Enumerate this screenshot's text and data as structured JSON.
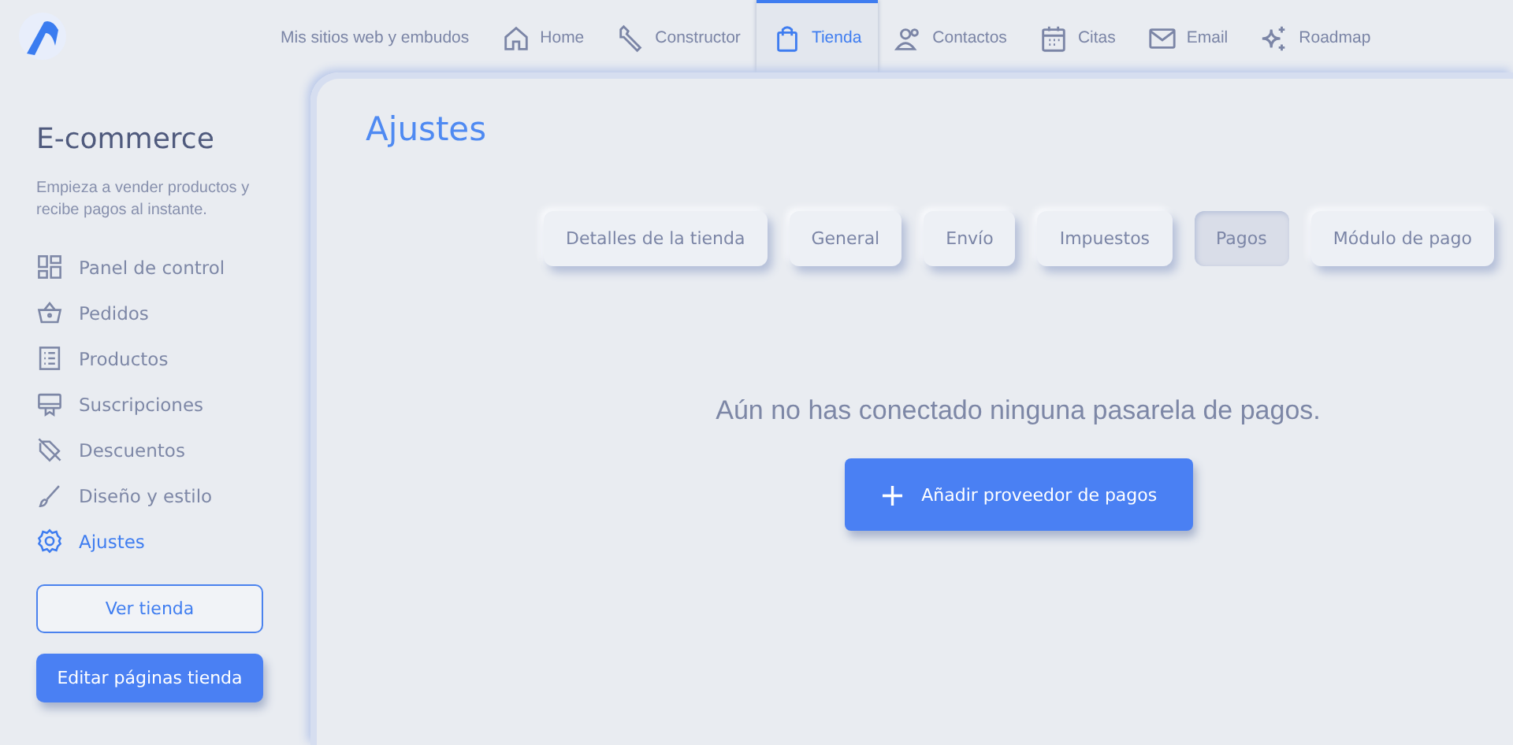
{
  "topnav": [
    {
      "label": "Mis sitios web y embudos",
      "selected": false
    },
    {
      "label": "Home",
      "selected": false
    },
    {
      "label": "Constructor",
      "selected": false
    },
    {
      "label": "Tienda",
      "selected": true
    },
    {
      "label": "Contactos",
      "selected": false
    },
    {
      "label": "Citas",
      "selected": false
    },
    {
      "label": "Email",
      "selected": false
    },
    {
      "label": "Roadmap",
      "selected": false
    }
  ],
  "sidebar": {
    "title": "E-commerce",
    "description": "Empieza a vender productos y recibe pagos al instante.",
    "items": [
      {
        "label": "Panel de control",
        "selected": false
      },
      {
        "label": "Pedidos",
        "selected": false
      },
      {
        "label": "Productos",
        "selected": false
      },
      {
        "label": "Suscripciones",
        "selected": false
      },
      {
        "label": "Descuentos",
        "selected": false
      },
      {
        "label": "Diseño y estilo",
        "selected": false
      },
      {
        "label": "Ajustes",
        "selected": true
      }
    ],
    "buttons": [
      {
        "label": "Ver tienda",
        "kind": "outline"
      },
      {
        "label": "Editar páginas tienda",
        "kind": "primary"
      }
    ]
  },
  "main": {
    "title": "Ajustes",
    "tabs": [
      {
        "label": "Detalles de la tienda",
        "selected": false
      },
      {
        "label": "General",
        "selected": false
      },
      {
        "label": "Envío",
        "selected": false
      },
      {
        "label": "Impuestos",
        "selected": false
      },
      {
        "label": "Pagos",
        "selected": true
      },
      {
        "label": "Módulo de pago",
        "selected": false
      }
    ],
    "empty_message": "Aún no has conectado ninguna pasarela de pagos.",
    "action_button": {
      "icon": "+",
      "label": "Añadir proveedor de pagos"
    }
  }
}
